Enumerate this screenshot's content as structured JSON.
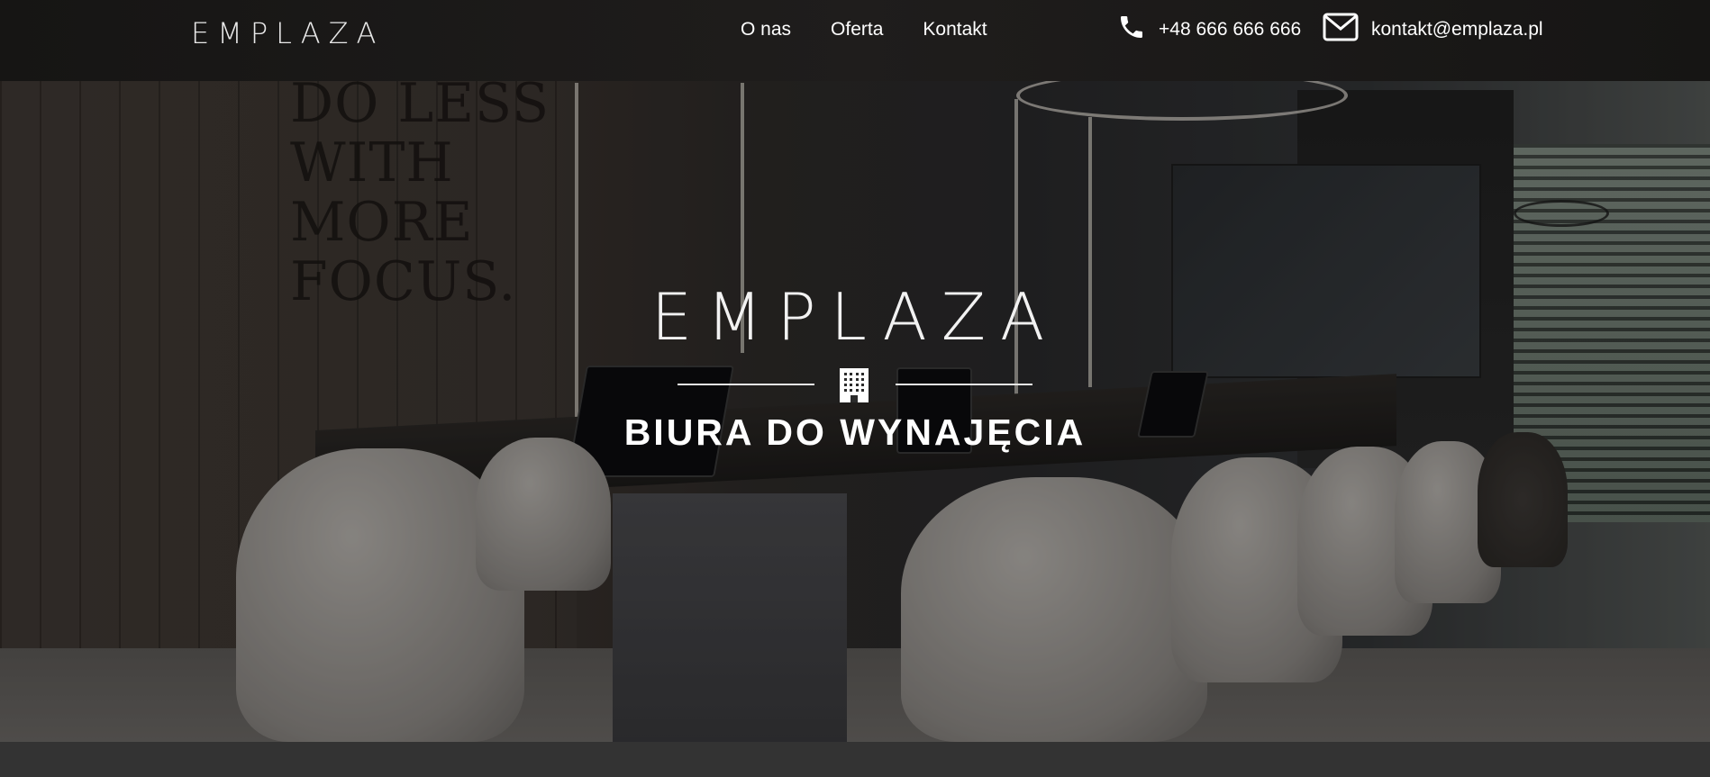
{
  "header": {
    "logo": "EMPLAZA",
    "nav": [
      {
        "label": "O nas"
      },
      {
        "label": "Oferta"
      },
      {
        "label": "Kontakt"
      }
    ],
    "phone": {
      "icon": "phone-icon",
      "text": "+48 666 666 666"
    },
    "email": {
      "icon": "envelope-icon",
      "text": "kontakt@emplaza.pl"
    }
  },
  "hero": {
    "logo": "EMPLAZA",
    "icon": "building-icon",
    "subtitle": "BIURA DO WYNAJĘCIA",
    "wall_text": [
      "DO LESS",
      "WITH",
      "MORE",
      "FOCUS."
    ]
  },
  "colors": {
    "header_bg": "#1a1918",
    "text": "#ffffff",
    "bottom_band": "#333333"
  }
}
